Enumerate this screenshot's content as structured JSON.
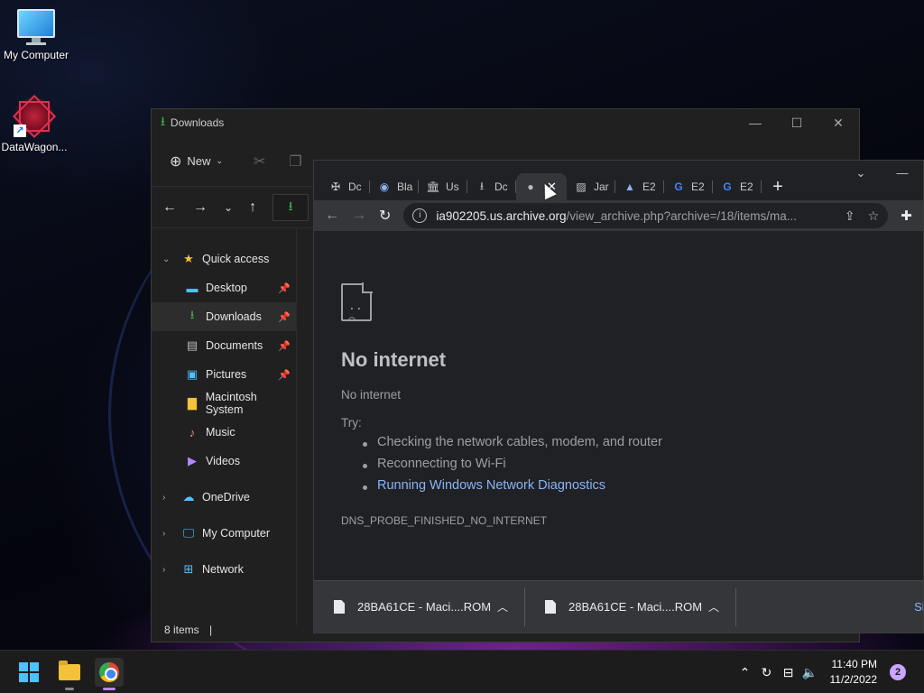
{
  "desktop": {
    "icons": [
      {
        "label": "My Computer",
        "icon": "monitor-icon"
      },
      {
        "label": "DataWagon...",
        "icon": "datawagon-icon"
      }
    ]
  },
  "explorer": {
    "title": "Downloads",
    "toolbar": {
      "new_label": "New"
    },
    "sidebar": [
      {
        "label": "Quick access",
        "icon": "star-icon",
        "pinned": false,
        "top": true
      },
      {
        "label": "Desktop",
        "icon": "desktop-icon",
        "pinned": true
      },
      {
        "label": "Downloads",
        "icon": "download-icon",
        "pinned": true,
        "selected": true
      },
      {
        "label": "Documents",
        "icon": "documents-icon",
        "pinned": true
      },
      {
        "label": "Pictures",
        "icon": "pictures-icon",
        "pinned": true
      },
      {
        "label": "Macintosh System",
        "icon": "folder-icon",
        "pinned": false
      },
      {
        "label": "Music",
        "icon": "music-icon",
        "pinned": false
      },
      {
        "label": "Videos",
        "icon": "videos-icon",
        "pinned": false
      },
      {
        "label": "OneDrive",
        "icon": "cloud-icon",
        "top": true
      },
      {
        "label": "My Computer",
        "icon": "monitor-icon",
        "top": true
      },
      {
        "label": "Network",
        "icon": "network-icon",
        "top": true
      }
    ],
    "status": "8 items"
  },
  "chrome": {
    "tabs": [
      {
        "label": "Dc",
        "icon": "wrench-icon"
      },
      {
        "label": "Bla",
        "icon": "globe-icon"
      },
      {
        "label": "Us",
        "icon": "archive-icon"
      },
      {
        "label": "Dc",
        "icon": "download-icon"
      },
      {
        "label": "",
        "icon": "globe-icon",
        "active": true
      },
      {
        "label": "Jar",
        "icon": "image-icon"
      },
      {
        "label": "E2",
        "icon": "triangle-icon"
      },
      {
        "label": "E2",
        "icon": "google-icon"
      },
      {
        "label": "E2",
        "icon": "google-icon"
      }
    ],
    "url_host": "ia902205.us.archive.org",
    "url_rest": "/view_archive.php?archive=/18/items/ma...",
    "error": {
      "title": "No internet",
      "subtitle": "No internet",
      "try_label": "Try:",
      "suggestions": [
        "Checking the network cables, modem, and router",
        "Reconnecting to Wi-Fi",
        "Running Windows Network Diagnostics"
      ],
      "code": "DNS_PROBE_FINISHED_NO_INTERNET"
    },
    "downloads": [
      {
        "name": "28BA61CE - Maci....ROM"
      },
      {
        "name": "28BA61CE - Maci....ROM"
      }
    ],
    "show_all": "Sh"
  },
  "taskbar": {
    "time": "11:40 PM",
    "date": "11/2/2022",
    "notifications": "2"
  }
}
